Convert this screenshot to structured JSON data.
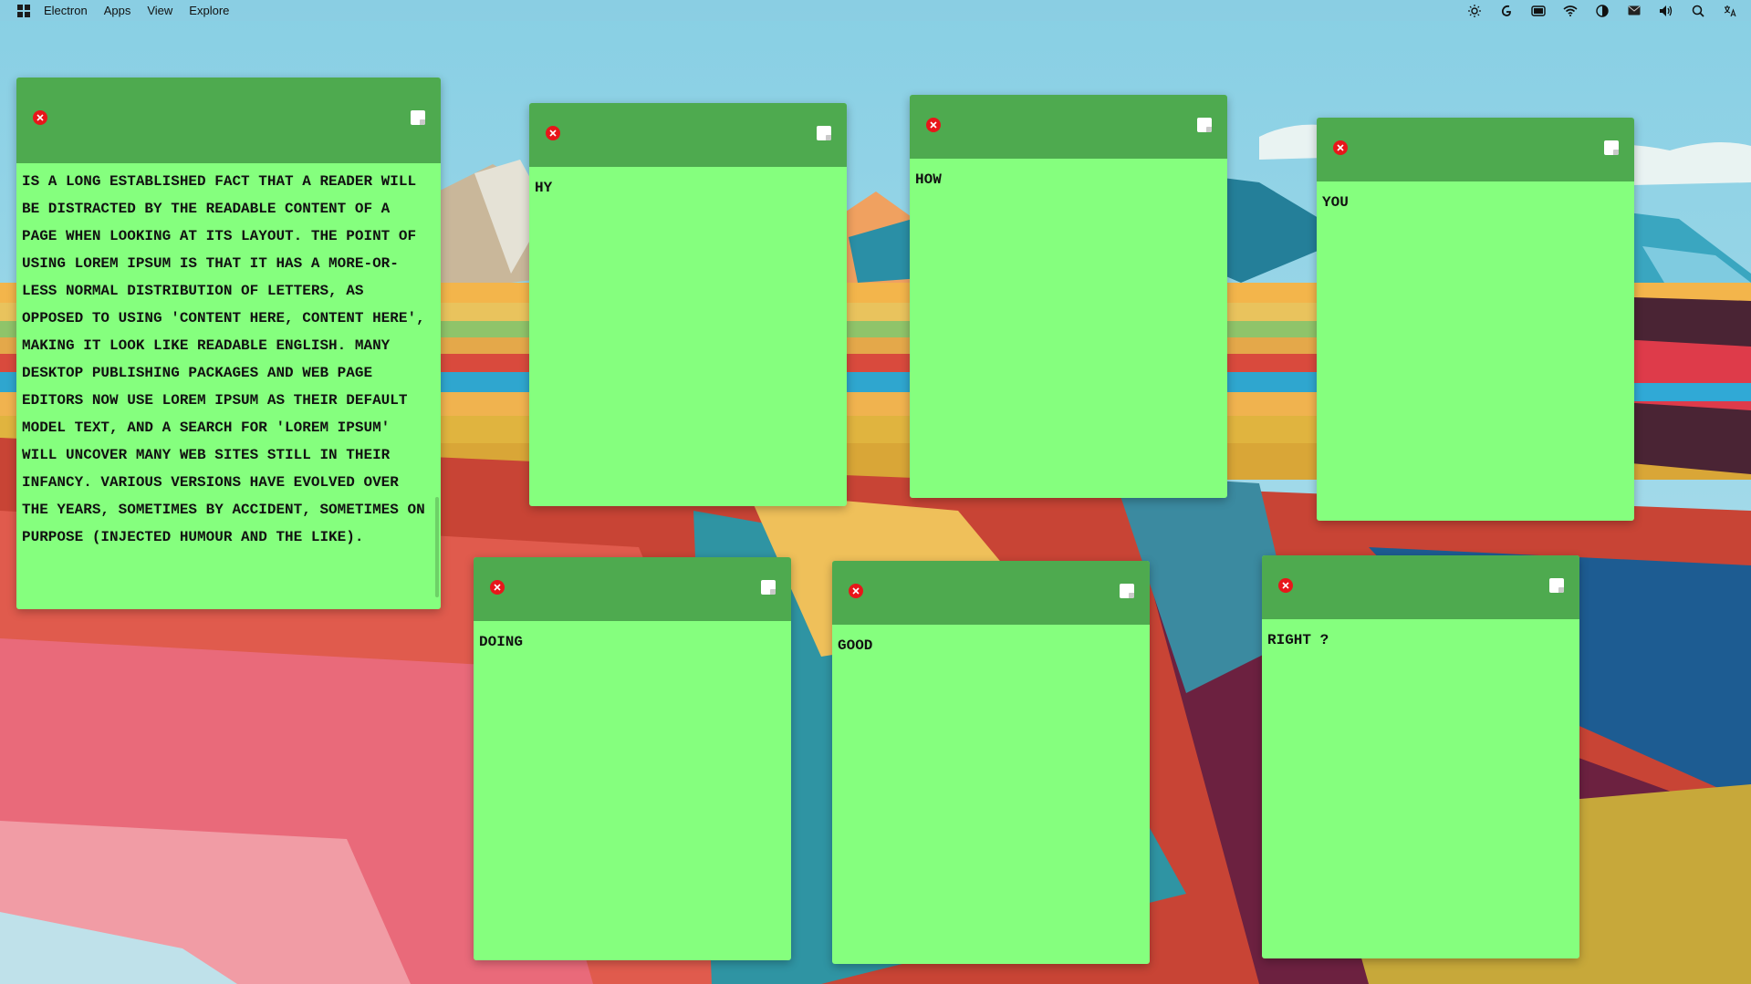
{
  "menubar": {
    "logo_icon": "windows-logo-icon",
    "items": [
      "Electron",
      "Apps",
      "View",
      "Explore"
    ],
    "tray_icons": [
      "brightness-icon",
      "nyt-icon",
      "battery-icon",
      "wifi-icon",
      "theme-toggle-icon",
      "mail-icon",
      "volume-icon",
      "search-icon",
      "language-icon"
    ]
  },
  "colors": {
    "note_header": "#4eaa4f",
    "note_body": "#85ff7e",
    "close_button": "#e8161a"
  },
  "notes": [
    {
      "text": "IS A LONG ESTABLISHED FACT THAT A READER WILL BE DISTRACTED BY THE READABLE CONTENT OF A PAGE WHEN LOOKING AT ITS LAYOUT. THE POINT OF USING LOREM IPSUM IS THAT IT HAS A MORE-OR-LESS NORMAL DISTRIBUTION OF LETTERS, AS OPPOSED TO USING 'CONTENT HERE, CONTENT HERE', MAKING IT LOOK LIKE READABLE ENGLISH. MANY DESKTOP PUBLISHING PACKAGES AND WEB PAGE EDITORS NOW USE LOREM IPSUM AS THEIR DEFAULT MODEL TEXT, AND A SEARCH FOR 'LOREM IPSUM' WILL UNCOVER MANY WEB SITES STILL IN THEIR INFANCY. VARIOUS VERSIONS HAVE EVOLVED OVER THE YEARS, SOMETIMES BY ACCIDENT, SOMETIMES ON PURPOSE (INJECTED HUMOUR AND THE LIKE)."
    },
    {
      "text": "HY"
    },
    {
      "text": "HOW"
    },
    {
      "text": "YOU"
    },
    {
      "text": "DOING"
    },
    {
      "text": "GOOD"
    },
    {
      "text": "RIGHT ?"
    }
  ]
}
